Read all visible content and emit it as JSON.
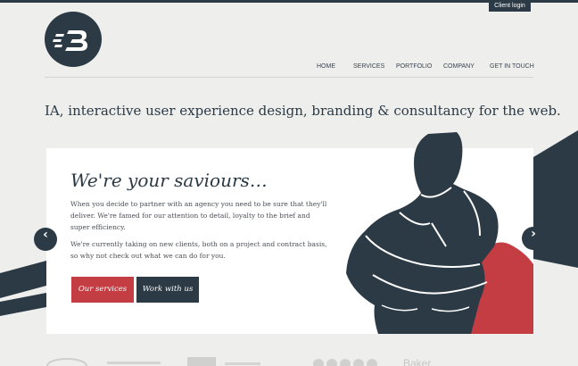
{
  "header": {
    "client_login": "Client login",
    "logo_icon": "b-monogram-logo"
  },
  "nav": {
    "items": [
      {
        "label": "HOME",
        "active": true
      },
      {
        "label": "SERVICES",
        "active": false
      },
      {
        "label": "PORTFOLIO",
        "active": false
      },
      {
        "label": "COMPANY",
        "active": false
      },
      {
        "label": "GET IN TOUCH",
        "active": false
      }
    ]
  },
  "tagline": "IA, interactive user experience design, branding & consultancy for the web.",
  "hero": {
    "heading": "We're your saviours…",
    "paragraph_1": "When you decide to partner with an agency you need to be sure that they'll deliver. We're famed for our attention to detail, loyalty to the brief and super efficiency.",
    "paragraph_2": "We're currently taking on new clients, both on a project and contract basis, so why not check out what we can do for you.",
    "buttons": {
      "services": "Our services",
      "work": "Work with us"
    },
    "illustration": "superhero-arms-crossed"
  },
  "slider": {
    "prev_icon": "chevron-left-icon",
    "next_icon": "chevron-right-icon"
  },
  "clients": {
    "logos": [
      "Baker"
    ]
  },
  "colors": {
    "navy": "#2b3a45",
    "red": "#c43d43",
    "background": "#eeeeec",
    "panel": "#ffffff"
  }
}
